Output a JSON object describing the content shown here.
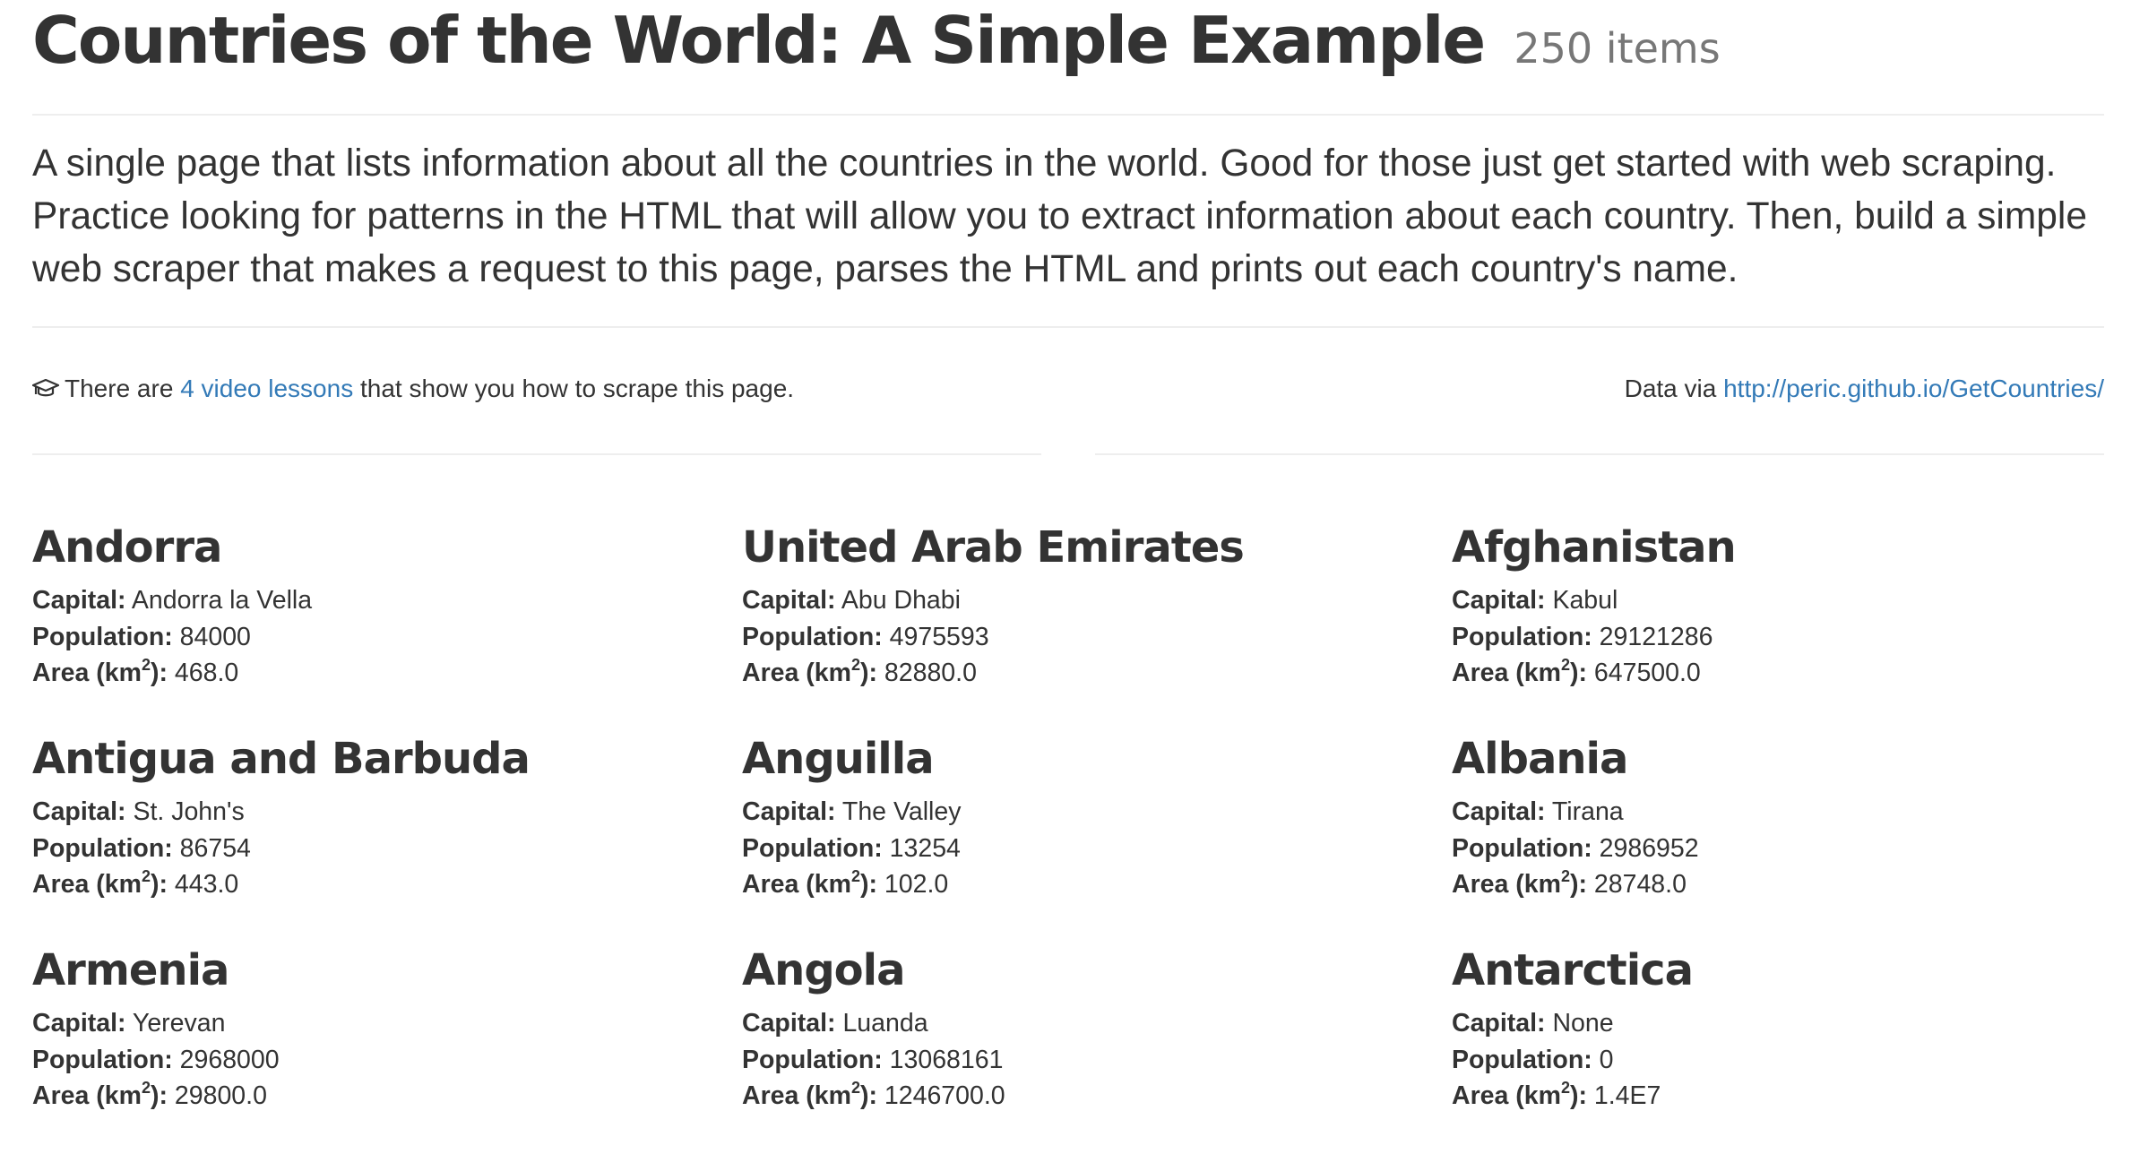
{
  "header": {
    "title": "Countries of the World: A Simple Example",
    "count": "250 items"
  },
  "lead": "A single page that lists information about all the countries in the world. Good for those just get started with web scraping. Practice looking for patterns in the HTML that will allow you to extract information about each country. Then, build a simple web scraper that makes a request to this page, parses the HTML and prints out each country's name.",
  "info": {
    "icon": "graduation-cap-icon",
    "prefix": "There are",
    "lessons_link": "4 video lessons",
    "suffix": "that show you how to scrape this page.",
    "data_via": "Data via",
    "source_link": "http://peric.github.io/GetCountries/"
  },
  "labels": {
    "capital": "Capital:",
    "population": "Population:",
    "area_prefix": "Area (km",
    "area_sup": "2",
    "area_suffix": "):"
  },
  "countries": [
    {
      "name": "Andorra",
      "capital": "Andorra la Vella",
      "population": "84000",
      "area": "468.0"
    },
    {
      "name": "United Arab Emirates",
      "capital": "Abu Dhabi",
      "population": "4975593",
      "area": "82880.0"
    },
    {
      "name": "Afghanistan",
      "capital": "Kabul",
      "population": "29121286",
      "area": "647500.0"
    },
    {
      "name": "Antigua and Barbuda",
      "capital": "St. John's",
      "population": "86754",
      "area": "443.0"
    },
    {
      "name": "Anguilla",
      "capital": "The Valley",
      "population": "13254",
      "area": "102.0"
    },
    {
      "name": "Albania",
      "capital": "Tirana",
      "population": "2986952",
      "area": "28748.0"
    },
    {
      "name": "Armenia",
      "capital": "Yerevan",
      "population": "2968000",
      "area": "29800.0"
    },
    {
      "name": "Angola",
      "capital": "Luanda",
      "population": "13068161",
      "area": "1246700.0"
    },
    {
      "name": "Antarctica",
      "capital": "None",
      "population": "0",
      "area": "1.4E7"
    }
  ],
  "colors": {
    "text": "#333333",
    "muted": "#777777",
    "link": "#337ab7",
    "rule": "#eeeeee"
  }
}
